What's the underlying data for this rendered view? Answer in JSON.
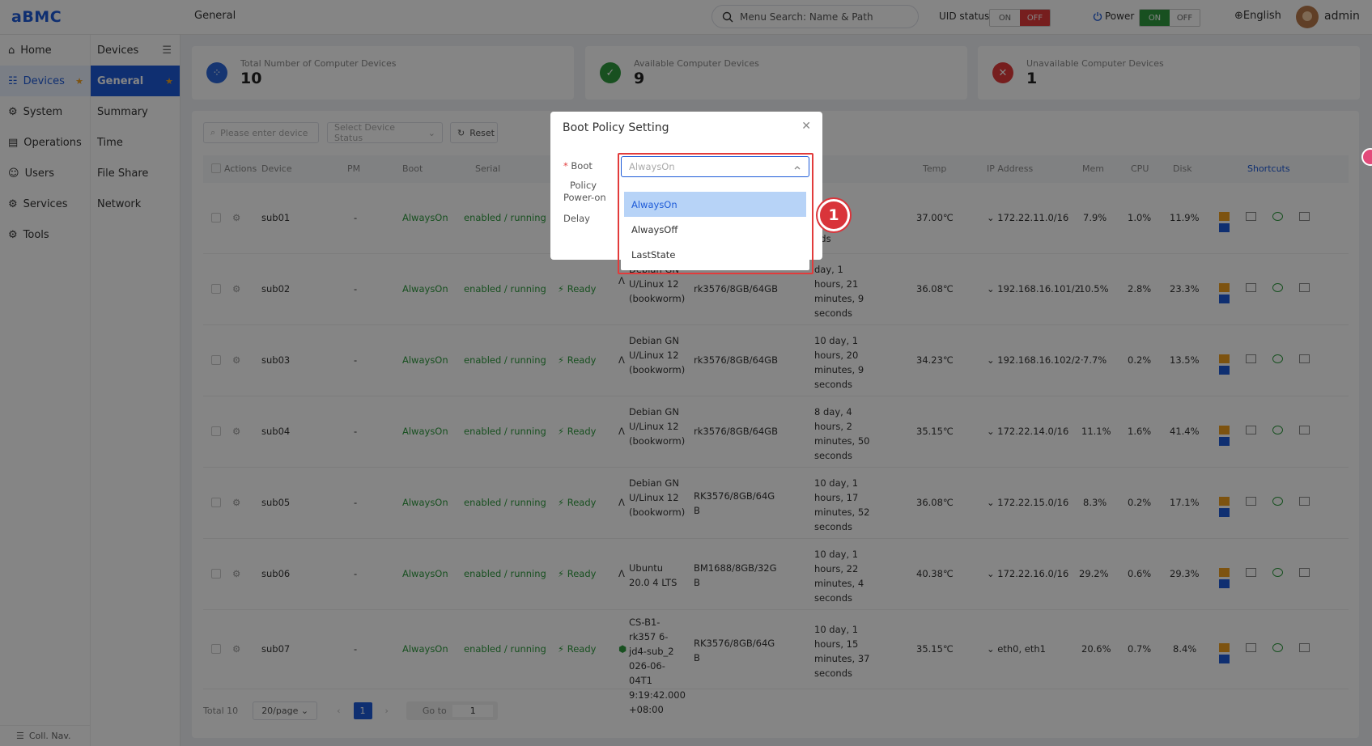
{
  "header": {
    "logo": "aBMC",
    "page_title": "General",
    "search_placeholder": "Menu Search: Name & Path",
    "uid_label": "UID status",
    "uid_on": "ON",
    "uid_off": "OFF",
    "power_label": "Power",
    "power_on": "ON",
    "power_off": "OFF",
    "language": "English",
    "user": "admin"
  },
  "nav1": {
    "items": [
      {
        "label": "Home",
        "icon": "home-icon"
      },
      {
        "label": "Devices",
        "icon": "devices-icon"
      },
      {
        "label": "System",
        "icon": "system-icon"
      },
      {
        "label": "Operations",
        "icon": "operations-icon"
      },
      {
        "label": "Users",
        "icon": "users-icon"
      },
      {
        "label": "Services",
        "icon": "services-icon"
      },
      {
        "label": "Tools",
        "icon": "tools-icon"
      }
    ],
    "collapse_label": "Coll. Nav."
  },
  "nav2": {
    "header": "Devices",
    "items": [
      "General",
      "Summary",
      "Time",
      "File Share",
      "Network"
    ]
  },
  "cards": [
    {
      "label": "Total Number of Computer Devices",
      "value": "10",
      "color": "#2b67d8"
    },
    {
      "label": "Available Computer Devices",
      "value": "9",
      "color": "#2e9a3e"
    },
    {
      "label": "Unavailable Computer Devices",
      "value": "1",
      "color": "#e23b3b"
    }
  ],
  "filters": {
    "device_placeholder": "Please enter device",
    "status_placeholder": "Select Device Status",
    "reset_label": "Reset"
  },
  "table": {
    "headers": {
      "actions": "Actions",
      "device": "Device",
      "pm": "PM",
      "boot": "Boot",
      "serial": "Serial",
      "temp": "Temp",
      "ip": "IP Address",
      "mem": "Mem",
      "cpu": "CPU",
      "disk": "Disk",
      "shortcuts": "Shortcuts"
    },
    "rows": [
      {
        "device": "sub01",
        "pm": "-",
        "boot": "AlwaysOn",
        "serial": "enabled / running",
        "status": "",
        "os": "",
        "hw": "",
        "uptime": "nds",
        "temp": "37.00℃",
        "ip": "172.22.11.0/16",
        "mem": "7.9%",
        "cpu": "1.0%",
        "disk": "11.9%"
      },
      {
        "device": "sub02",
        "pm": "-",
        "boot": "AlwaysOn",
        "serial": "enabled / running",
        "status": "Ready",
        "os": "Debian GN U/Linux 12 (bookworm)",
        "hw": "rk3576/8GB/64GB",
        "uptime": "day, 1 hours, 21 minutes, 9 seconds",
        "temp": "36.08℃",
        "ip": "192.168.16.101/2·",
        "mem": "10.5%",
        "cpu": "2.8%",
        "disk": "23.3%"
      },
      {
        "device": "sub03",
        "pm": "-",
        "boot": "AlwaysOn",
        "serial": "enabled / running",
        "status": "Ready",
        "os": "Debian GN U/Linux 12 (bookworm)",
        "hw": "rk3576/8GB/64GB",
        "uptime": "10 day, 1 hours, 20 minutes, 9 seconds",
        "temp": "34.23℃",
        "ip": "192.168.16.102/2·",
        "mem": "7.7%",
        "cpu": "0.2%",
        "disk": "13.5%"
      },
      {
        "device": "sub04",
        "pm": "-",
        "boot": "AlwaysOn",
        "serial": "enabled / running",
        "status": "Ready",
        "os": "Debian GN U/Linux 12 (bookworm)",
        "hw": "rk3576/8GB/64GB",
        "uptime": "8 day, 4 hours, 2 minutes, 50 seconds",
        "temp": "35.15℃",
        "ip": "172.22.14.0/16",
        "mem": "11.1%",
        "cpu": "1.6%",
        "disk": "41.4%"
      },
      {
        "device": "sub05",
        "pm": "-",
        "boot": "AlwaysOn",
        "serial": "enabled / running",
        "status": "Ready",
        "os": "Debian GN U/Linux 12 (bookworm)",
        "hw": "RK3576/8GB/64G B",
        "uptime": "10 day, 1 hours, 17 minutes, 52 seconds",
        "temp": "36.08℃",
        "ip": "172.22.15.0/16",
        "mem": "8.3%",
        "cpu": "0.2%",
        "disk": "17.1%"
      },
      {
        "device": "sub06",
        "pm": "-",
        "boot": "AlwaysOn",
        "serial": "enabled / running",
        "status": "Ready",
        "os": "Ubuntu 20.0 4 LTS",
        "hw": "BM1688/8GB/32G B",
        "uptime": "10 day, 1 hours, 22 minutes, 4 seconds",
        "temp": "40.38℃",
        "ip": "172.22.16.0/16",
        "mem": "29.2%",
        "cpu": "0.6%",
        "disk": "29.3%"
      },
      {
        "device": "sub07",
        "pm": "-",
        "boot": "AlwaysOn",
        "serial": "enabled / running",
        "status": "Ready",
        "os": "CS-B1-rk357 6-jd4-sub_2 026-06-04T1 9:19:42.000 +08:00",
        "hw": "RK3576/8GB/64G B",
        "uptime": "10 day, 1 hours, 15 minutes, 37 seconds",
        "temp": "35.15℃",
        "ip": "eth0, eth1",
        "mem": "20.6%",
        "cpu": "0.7%",
        "disk": "8.4%"
      }
    ]
  },
  "pagination": {
    "total": "Total 10",
    "page_size": "20/page",
    "current_page": "1",
    "goto_label": "Go to",
    "goto_value": "1"
  },
  "modal": {
    "title": "Boot Policy Setting",
    "boot_label": "Boot",
    "policy_label": "Policy",
    "poweron_label": "Power-on",
    "delay_label": "Delay",
    "select_value": "AlwaysOn",
    "options": [
      "AlwaysOn",
      "AlwaysOff",
      "LastState"
    ],
    "badge": "1"
  }
}
